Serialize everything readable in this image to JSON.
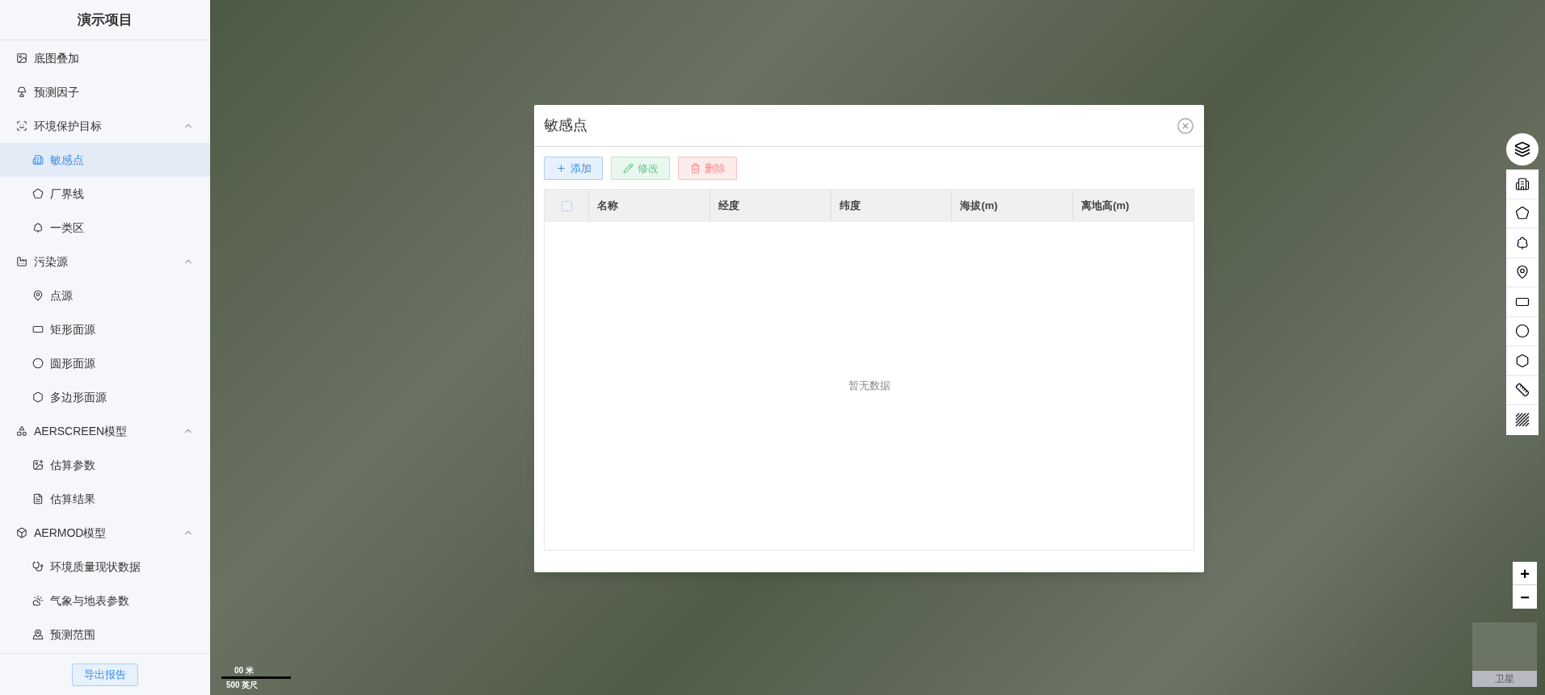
{
  "sidebar": {
    "title": "演示项目",
    "items": [
      {
        "label": "底图叠加",
        "selected": false
      },
      {
        "label": "预测因子",
        "selected": false
      },
      {
        "label": "环境保护目标",
        "expanded": true,
        "selected": false,
        "children": [
          {
            "label": "敏感点",
            "selected": true
          },
          {
            "label": "厂界线",
            "selected": false
          },
          {
            "label": "一类区",
            "selected": false
          }
        ]
      },
      {
        "label": "污染源",
        "expanded": true,
        "selected": false,
        "children": [
          {
            "label": "点源",
            "selected": false
          },
          {
            "label": "矩形面源",
            "selected": false
          },
          {
            "label": "圆形面源",
            "selected": false
          },
          {
            "label": "多边形面源",
            "selected": false
          }
        ]
      },
      {
        "label": "AERSCREEN模型",
        "expanded": true,
        "selected": false,
        "children": [
          {
            "label": "估算参数",
            "selected": false
          },
          {
            "label": "估算结果",
            "selected": false
          }
        ]
      },
      {
        "label": "AERMOD模型",
        "expanded": true,
        "selected": false,
        "children": [
          {
            "label": "环境质量现状数据",
            "selected": false
          },
          {
            "label": "气象与地表参数",
            "selected": false
          },
          {
            "label": "预测范围",
            "selected": false
          }
        ]
      }
    ],
    "export_button": "导出报告"
  },
  "dialog": {
    "title": "敏感点",
    "buttons": [
      {
        "kind": "add",
        "label": "添加"
      },
      {
        "kind": "edit",
        "label": "修改"
      },
      {
        "kind": "delete",
        "label": "删除"
      }
    ],
    "table": {
      "select_all_checked": false,
      "columns": [
        "名称",
        "经度",
        "纬度",
        "海拔(m)",
        "离地高(m)"
      ],
      "empty_text": "暂无数据"
    }
  },
  "map": {
    "zoom_in": "+",
    "zoom_out": "−",
    "minimap_label": "卫星",
    "scale_labels": [
      "00 米",
      "500 英尺"
    ]
  }
}
